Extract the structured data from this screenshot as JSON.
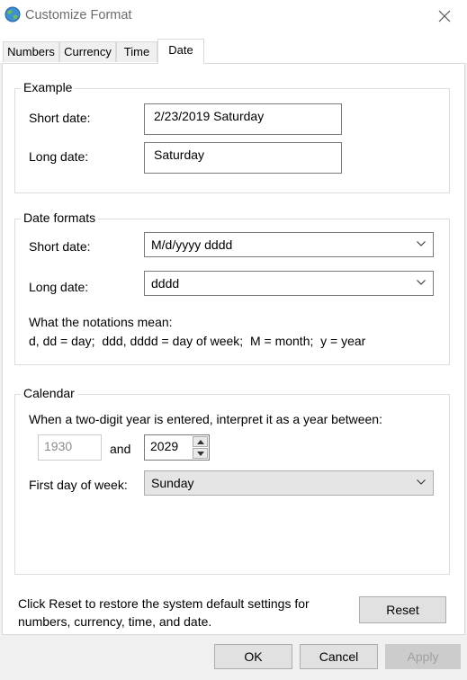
{
  "window": {
    "title": "Customize Format",
    "icon": "globe-icon",
    "close_icon": "close-icon"
  },
  "tabs": [
    {
      "label": "Numbers"
    },
    {
      "label": "Currency"
    },
    {
      "label": "Time"
    },
    {
      "label": "Date",
      "active": true
    }
  ],
  "example": {
    "legend": "Example",
    "short_label": "Short date:",
    "short_value": "2/23/2019 Saturday",
    "long_label": "Long date:",
    "long_value": "Saturday"
  },
  "formats": {
    "legend": "Date formats",
    "short_label": "Short date:",
    "short_value": "M/d/yyyy dddd",
    "long_label": "Long date:",
    "long_value": "dddd",
    "notations_title": "What the notations mean:",
    "notations": "d, dd = day;  ddd, dddd = day of week;  M = month;  y = year"
  },
  "calendar": {
    "legend": "Calendar",
    "two_digit_text": "When a two-digit year is entered, interpret it as a year between:",
    "year_from": "1930",
    "and_label": "and",
    "year_to": "2029",
    "first_day_label": "First day of week:",
    "first_day_value": "Sunday"
  },
  "footer": {
    "reset_text": "Click Reset to restore the system default settings for numbers, currency, time, and date.",
    "reset_button": "Reset"
  },
  "buttons": {
    "ok": "OK",
    "cancel": "Cancel",
    "apply": "Apply"
  }
}
